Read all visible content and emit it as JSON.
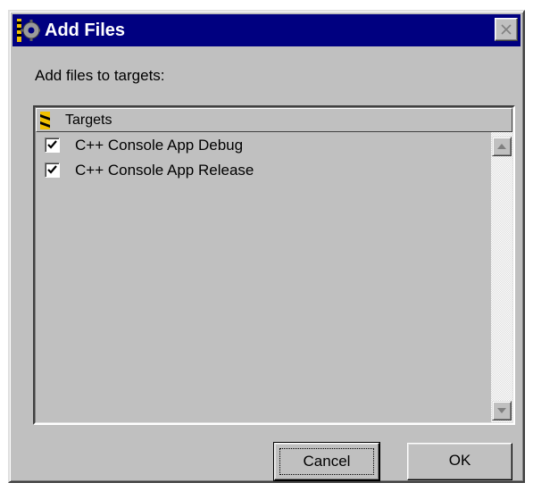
{
  "window": {
    "title": "Add Files",
    "close_icon": "close-icon",
    "title_icon": "gear-icon"
  },
  "prompt": "Add files to targets:",
  "targets": {
    "column_header": "Targets",
    "column_icon": "target-stripe-icon",
    "items": [
      {
        "label": "C++ Console App Debug",
        "checked": true
      },
      {
        "label": "C++ Console App Release",
        "checked": true
      }
    ]
  },
  "buttons": {
    "cancel": "Cancel",
    "ok": "OK"
  },
  "colors": {
    "titlebar": "#000080",
    "face": "#c0c0c0",
    "title_text": "#ffffff"
  }
}
